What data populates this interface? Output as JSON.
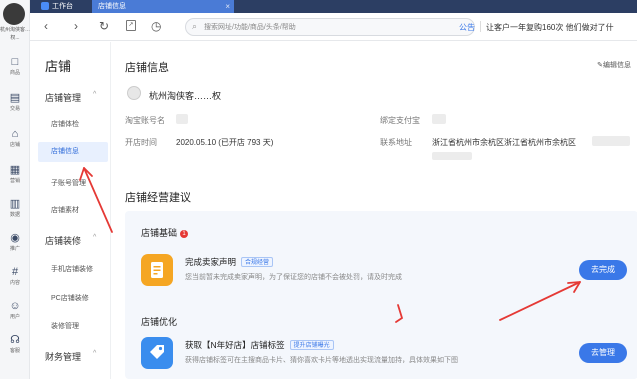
{
  "tabs": [
    {
      "label": "工作台"
    },
    {
      "label": "店铺信息",
      "close": "×"
    }
  ],
  "user": {
    "store_line1": "杭州淘侠客…",
    "store_line2": "权..."
  },
  "rail": [
    {
      "icon": "□",
      "label": "商品"
    },
    {
      "icon": "▤",
      "label": "交易"
    },
    {
      "icon": "⌂",
      "label": "店铺"
    },
    {
      "icon": "▦",
      "label": "营销"
    },
    {
      "icon": "▥",
      "label": "数据"
    },
    {
      "icon": "◉",
      "label": "推广"
    },
    {
      "icon": "#",
      "label": "内容"
    },
    {
      "icon": "☺",
      "label": "用户"
    },
    {
      "icon": "☊",
      "label": "客服"
    }
  ],
  "toolbar": {
    "back": "‹",
    "forward": "›",
    "refresh": "↻",
    "clock": "◷",
    "search_placeholder": "搜索网址/功能/商品/头条/帮助",
    "notice_label": "公告",
    "notice_text": "让客户一年复购160次 他们做对了什"
  },
  "sidebar": {
    "title": "店铺",
    "groups": [
      {
        "label": "店铺管理",
        "caret": "^",
        "items": [
          "店铺体检",
          "店铺信息",
          "子账号管理",
          "店铺素材"
        ]
      },
      {
        "label": "店铺装修",
        "caret": "^",
        "items": [
          "手机店铺装修",
          "PC店铺装修",
          "装修管理"
        ]
      },
      {
        "label": "财务管理",
        "caret": "^",
        "items": []
      }
    ]
  },
  "main": {
    "title": "店铺信息",
    "edit_link": "编辑信息",
    "shop_name": "杭州淘侠客……权",
    "fields": {
      "taobao_account_label": "淘宝账号名",
      "alipay_label": "绑定支付宝",
      "open_time_label": "开店时间",
      "open_time_value": "2020.05.10 (已开店 793 天)",
      "address_label": "联系地址",
      "address_value": "浙江省杭州市余杭区浙江省杭州市余杭区"
    },
    "advice_title": "店铺经营建议",
    "sections": [
      {
        "title": "店铺基础",
        "badge": "1",
        "card": {
          "icon": "document",
          "title": "完成卖家声明",
          "tag": "合规经营",
          "desc": "您当前暂未完成卖家声明，为了保证您的店铺不会被处罚，请及时完成",
          "button": "去完成"
        }
      },
      {
        "title": "店铺优化",
        "card": {
          "icon": "tag",
          "title": "获取【N年好店】店铺标签",
          "tag": "提升店铺曝光",
          "desc": "获得店铺标签可在主搜商品卡片、猜你喜欢卡片等地透出实现流量加持，具体效果如下图",
          "button": "去管理"
        }
      }
    ]
  },
  "colors": {
    "accent": "#3a78e8",
    "tabbar": "#2c3e63",
    "annotation": "#e53935"
  }
}
